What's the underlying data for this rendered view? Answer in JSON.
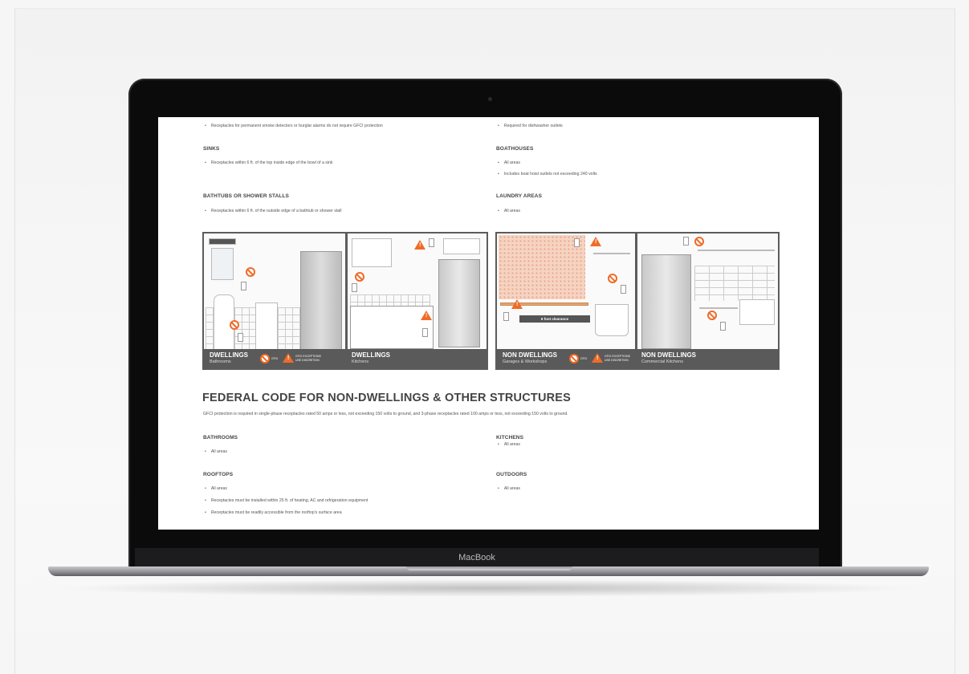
{
  "device": {
    "brand_label": "MacBook"
  },
  "top_section": {
    "left_bullet_top": "Receptacles for permanent smoke detectors or burglar alarms do not require GFCI protection",
    "right_bullet_top": "Required for dishwasher outlets",
    "sinks": {
      "heading": "SINKS",
      "bullets": [
        "Receptacles within 6 ft. of the top inside edge of the bowl of a sink"
      ]
    },
    "boathouses": {
      "heading": "BOATHOUSES",
      "bullets": [
        "All areas",
        "Includes boat hoist outlets not exceeding 240 volts"
      ]
    },
    "bathtubs": {
      "heading": "BATHTUBS OR SHOWER STALLS",
      "bullets": [
        "Receptacles within 6 ft. of the outside edge of a bathtub or shower stall"
      ]
    },
    "laundry": {
      "heading": "LAUNDRY AREAS",
      "bullets": [
        "All areas"
      ]
    }
  },
  "illustrations": {
    "left_panel": {
      "a_title": "DWELLINGS",
      "a_sub": "Bathrooms",
      "legend_gfci": "GFCI",
      "legend_exceptions_1": "GFCI EXCEPTIONS",
      "legend_exceptions_2": "USE DISCRETION",
      "b_title": "DWELLINGS",
      "b_sub": "Kitchens"
    },
    "right_panel": {
      "a_title": "NON DWELLINGS",
      "a_sub": "Garages & Workshops",
      "clearance": "6 foot clearance",
      "legend_gfci": "GFCI",
      "legend_exceptions_1": "GFCI EXCEPTIONS",
      "legend_exceptions_2": "USE DISCRETION",
      "b_title": "NON DWELLINGS",
      "b_sub": "Commercial Kitchens"
    }
  },
  "federal": {
    "title": "FEDERAL CODE FOR NON-DWELLINGS & OTHER STRUCTURES",
    "paragraph": "GFCI protection is required in single-phase receptacles rated 50 amps or less, not exceeding 150 volts to ground, and 3-phase receptacles rated 100 amps or less, not exceeding 150 volts to ground.",
    "bathrooms": {
      "heading": "BATHROOMS",
      "bullets": [
        "All areas"
      ]
    },
    "kitchens": {
      "heading": "KITCHENS",
      "bullets": [
        "All areas"
      ]
    },
    "rooftops": {
      "heading": "ROOFTOPS",
      "bullets": [
        "All areas",
        "Receptacles must be installed within 25 ft. of heating, AC and refrigeration equipment",
        "Receptacles must be readily accessible from the rooftop's surface area"
      ]
    },
    "outdoors": {
      "heading": "OUTDOORS",
      "bullets": [
        "All areas"
      ]
    }
  },
  "colors": {
    "accent": "#f06b26",
    "panel_dark": "#5a5a5a"
  }
}
